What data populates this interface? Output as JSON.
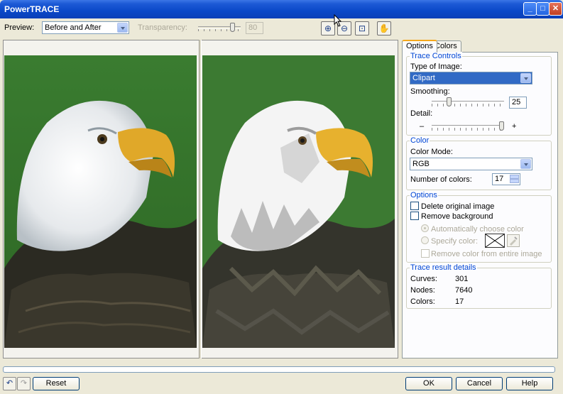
{
  "window": {
    "title": "PowerTRACE",
    "minimize": "_",
    "maximize": "□",
    "close": "✕"
  },
  "toolbar": {
    "preview_label": "Preview:",
    "preview_value": "Before and After",
    "transparency_label": "Transparency:",
    "transparency_value": "80",
    "tools": [
      {
        "name": "zoom-in-icon",
        "glyph": "⊕"
      },
      {
        "name": "zoom-out-icon",
        "glyph": "⊖"
      },
      {
        "name": "fit-to-window-icon",
        "glyph": "⊡"
      },
      {
        "name": "pan-hand-icon",
        "glyph": "✋"
      }
    ]
  },
  "tabs": {
    "options": "Options",
    "colors": "Colors"
  },
  "trace_controls": {
    "title": "Trace Controls",
    "type_label": "Type of Image:",
    "type_value": "Clipart",
    "smoothing_label": "Smoothing:",
    "smoothing_value": "25",
    "detail_label": "Detail:",
    "detail_min": "–",
    "detail_max": "+"
  },
  "color": {
    "title": "Color",
    "mode_label": "Color Mode:",
    "mode_value": "RGB",
    "num_colors_label": "Number of colors:",
    "num_colors_value": "17"
  },
  "options": {
    "title": "Options",
    "delete_original": "Delete original image",
    "remove_background": "Remove background",
    "auto_choose": "Automatically choose color",
    "specify_color": "Specify color:",
    "remove_entire": "Remove color from entire image"
  },
  "results": {
    "title": "Trace result details",
    "curves_label": "Curves:",
    "curves_value": "301",
    "nodes_label": "Nodes:",
    "nodes_value": "7640",
    "colors_label": "Colors:",
    "colors_value": "17"
  },
  "buttons": {
    "reset": "Reset",
    "ok": "OK",
    "cancel": "Cancel",
    "help": "Help"
  },
  "colors": {
    "background_green": "#3c7a32",
    "titlebar_blue": "#0a48c8",
    "selection_blue": "#316ac5"
  }
}
